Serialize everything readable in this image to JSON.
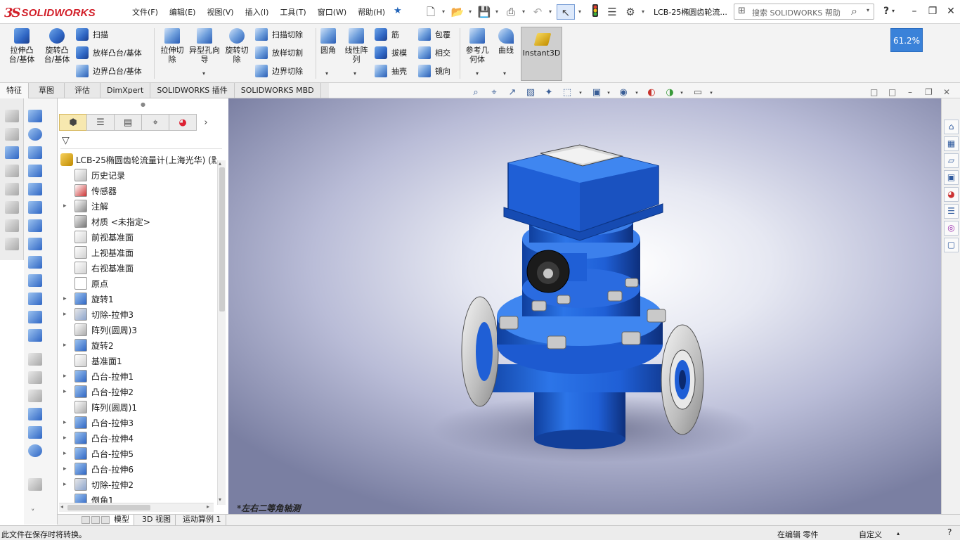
{
  "app": {
    "brand_prefix": "3S",
    "brand": "SOLIDWORKS",
    "doc_title": "LCB-25椭圆齿轮流...",
    "search_placeholder": "搜索 SOLIDWORKS 帮助",
    "help_label": "?"
  },
  "menu": [
    "文件(F)",
    "编辑(E)",
    "视图(V)",
    "插入(I)",
    "工具(T)",
    "窗口(W)",
    "帮助(H)"
  ],
  "ribbon": {
    "extrude_boss": "拉伸凸台/基体",
    "revolve_boss": "旋转凸台/基体",
    "sweep": "扫描",
    "loft_boss": "放样凸台/基体",
    "boundary_boss": "边界凸台/基体",
    "extrude_cut": "拉伸切除",
    "hole_wizard": "异型孔向导",
    "revolve_cut": "旋转切除",
    "sweep_cut": "扫描切除",
    "loft_cut": "放样切割",
    "boundary_cut": "边界切除",
    "fillet": "圆角",
    "linear_pattern": "线性阵列",
    "rib": "筋",
    "draft": "拔模",
    "shell": "抽壳",
    "wrap": "包覆",
    "intersect": "相交",
    "mirror": "镜向",
    "ref_geometry": "参考几何体",
    "curves": "曲线",
    "instant3d": "Instant3D"
  },
  "tabs": [
    "特征",
    "草图",
    "评估",
    "DimXpert",
    "SOLIDWORKS 插件",
    "SOLIDWORKS MBD"
  ],
  "tree": {
    "root": "LCB-25椭圆齿轮流量计(上海光华) (默",
    "items": [
      {
        "label": "历史记录",
        "icon": "history-icon",
        "expandable": false
      },
      {
        "label": "传感器",
        "icon": "sensor-icon",
        "expandable": false
      },
      {
        "label": "注解",
        "icon": "annotation-icon",
        "expandable": true
      },
      {
        "label": "材质 <未指定>",
        "icon": "material-icon",
        "expandable": false
      },
      {
        "label": "前视基准面",
        "icon": "plane-icon",
        "expandable": false
      },
      {
        "label": "上视基准面",
        "icon": "plane-icon",
        "expandable": false
      },
      {
        "label": "右视基准面",
        "icon": "plane-icon",
        "expandable": false
      },
      {
        "label": "原点",
        "icon": "origin-icon",
        "expandable": false
      },
      {
        "label": "旋转1",
        "icon": "revolve-icon",
        "expandable": true
      },
      {
        "label": "切除-拉伸3",
        "icon": "cut-extrude-icon",
        "expandable": true
      },
      {
        "label": "阵列(圆周)3",
        "icon": "circular-pattern-icon",
        "expandable": false
      },
      {
        "label": "旋转2",
        "icon": "revolve-icon",
        "expandable": true
      },
      {
        "label": "基准面1",
        "icon": "plane-icon",
        "expandable": false
      },
      {
        "label": "凸台-拉伸1",
        "icon": "boss-extrude-icon",
        "expandable": true
      },
      {
        "label": "凸台-拉伸2",
        "icon": "boss-extrude-icon",
        "expandable": true
      },
      {
        "label": "阵列(圆周)1",
        "icon": "circular-pattern-icon",
        "expandable": false
      },
      {
        "label": "凸台-拉伸3",
        "icon": "boss-extrude-icon",
        "expandable": true
      },
      {
        "label": "凸台-拉伸4",
        "icon": "boss-extrude-icon",
        "expandable": true
      },
      {
        "label": "凸台-拉伸5",
        "icon": "boss-extrude-icon",
        "expandable": true
      },
      {
        "label": "凸台-拉伸6",
        "icon": "boss-extrude-icon",
        "expandable": true
      },
      {
        "label": "切除-拉伸2",
        "icon": "cut-extrude-icon",
        "expandable": true
      },
      {
        "label": "倒角1",
        "icon": "chamfer-icon",
        "expandable": false
      }
    ]
  },
  "viewport": {
    "view_label": "*左右二等角轴测"
  },
  "bottom_tabs": [
    "模型",
    "3D 视图",
    "运动算例 1"
  ],
  "status": {
    "message": "此文件在保存时将转换。",
    "editing": "在编辑 零件",
    "units": "自定义"
  },
  "zoom_badge": "61.2%",
  "colors": {
    "model_blue": "#1f5fd6",
    "brand_red": "#d21e28",
    "zoom_badge": "#3a82d9"
  }
}
